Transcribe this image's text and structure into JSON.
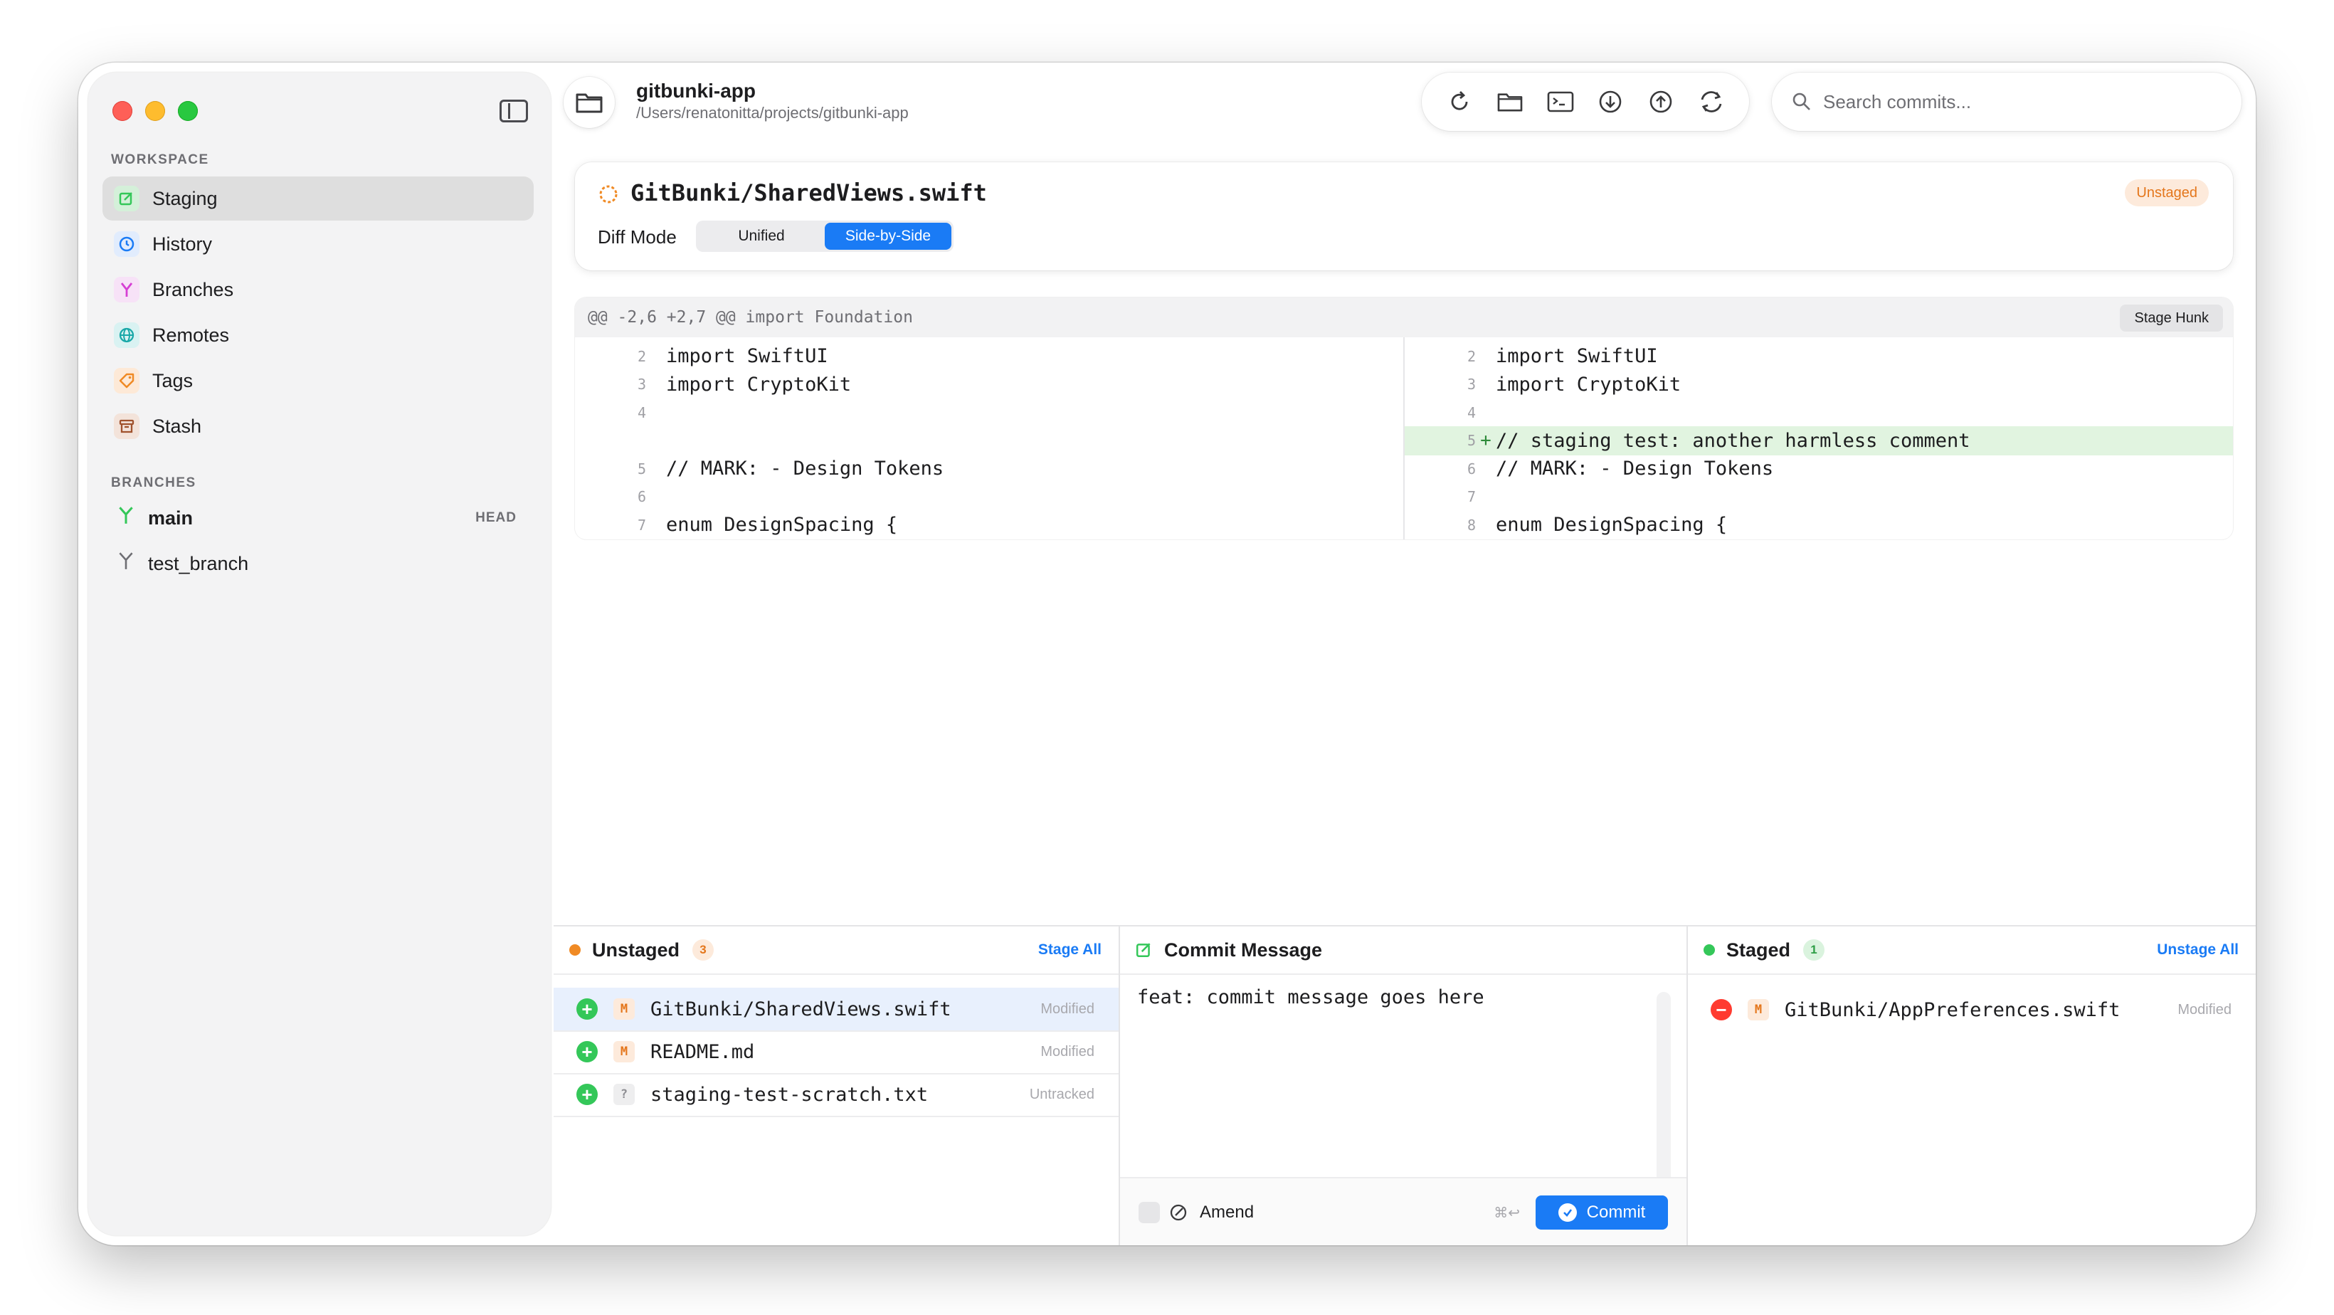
{
  "sidebar": {
    "workspace_label": "WORKSPACE",
    "items": [
      {
        "label": "Staging",
        "icon": "staging-icon",
        "color": "#34c759"
      },
      {
        "label": "History",
        "icon": "history-icon",
        "color": "#1a7bf5"
      },
      {
        "label": "Branches",
        "icon": "branches-icon",
        "color": "#d63fd4"
      },
      {
        "label": "Remotes",
        "icon": "remotes-icon",
        "color": "#1aa8a8"
      },
      {
        "label": "Tags",
        "icon": "tag-icon",
        "color": "#f08a24"
      },
      {
        "label": "Stash",
        "icon": "stash-icon",
        "color": "#a0522d"
      }
    ],
    "branches_label": "BRANCHES",
    "branches": [
      {
        "name": "main",
        "badge": "HEAD",
        "current": true
      },
      {
        "name": "test_branch",
        "badge": "",
        "current": false
      }
    ]
  },
  "repo": {
    "name": "gitbunki-app",
    "path": "/Users/renatonitta/projects/gitbunki-app"
  },
  "toolbar": {
    "buttons": [
      "refresh-icon",
      "folder-icon",
      "terminal-icon",
      "fetch-icon",
      "push-icon",
      "sync-icon"
    ]
  },
  "search": {
    "placeholder": "Search commits..."
  },
  "file_header": {
    "title": "GitBunki/SharedViews.swift",
    "status_badge": "Unstaged",
    "diff_mode_label": "Diff Mode",
    "modes": [
      "Unified",
      "Side-by-Side"
    ],
    "selected_mode": "Side-by-Side"
  },
  "diff": {
    "hunk_header": "@@ -2,6 +2,7 @@ import Foundation",
    "stage_hunk_label": "Stage Hunk",
    "left": [
      {
        "ln": "2",
        "code": "import SwiftUI"
      },
      {
        "ln": "3",
        "code": "import CryptoKit"
      },
      {
        "ln": "4",
        "code": ""
      },
      {
        "ln": "",
        "code": ""
      },
      {
        "ln": "5",
        "code": "// MARK: - Design Tokens"
      },
      {
        "ln": "6",
        "code": ""
      },
      {
        "ln": "7",
        "code": "enum DesignSpacing {"
      }
    ],
    "right": [
      {
        "ln": "2",
        "sign": "",
        "code": "import SwiftUI"
      },
      {
        "ln": "3",
        "sign": "",
        "code": "import CryptoKit"
      },
      {
        "ln": "4",
        "sign": "",
        "code": ""
      },
      {
        "ln": "5",
        "sign": "+",
        "code": "// staging test: another harmless comment",
        "added": true
      },
      {
        "ln": "6",
        "sign": "",
        "code": "// MARK: - Design Tokens"
      },
      {
        "ln": "7",
        "sign": "",
        "code": ""
      },
      {
        "ln": "8",
        "sign": "",
        "code": "enum DesignSpacing {"
      }
    ]
  },
  "unstaged": {
    "title": "Unstaged",
    "count": "3",
    "action": "Stage All",
    "files": [
      {
        "kind": "M",
        "name": "GitBunki/SharedViews.swift",
        "status": "Modified",
        "selected": true
      },
      {
        "kind": "M",
        "name": "README.md",
        "status": "Modified",
        "selected": false
      },
      {
        "kind": "?",
        "name": "staging-test-scratch.txt",
        "status": "Untracked",
        "selected": false
      }
    ]
  },
  "commit": {
    "title": "Commit Message",
    "message": "feat: commit message goes here",
    "amend_label": "Amend",
    "shortcut": "⌘↩",
    "button_label": "Commit"
  },
  "staged": {
    "title": "Staged",
    "count": "1",
    "action": "Unstage All",
    "files": [
      {
        "kind": "M",
        "name": "GitBunki/AppPreferences.swift",
        "status": "Modified"
      }
    ]
  },
  "colors": {
    "accent": "#1a7bf5",
    "unstaged": "#f08a24",
    "staged": "#34c759",
    "added_bg": "#e1f4e0"
  }
}
